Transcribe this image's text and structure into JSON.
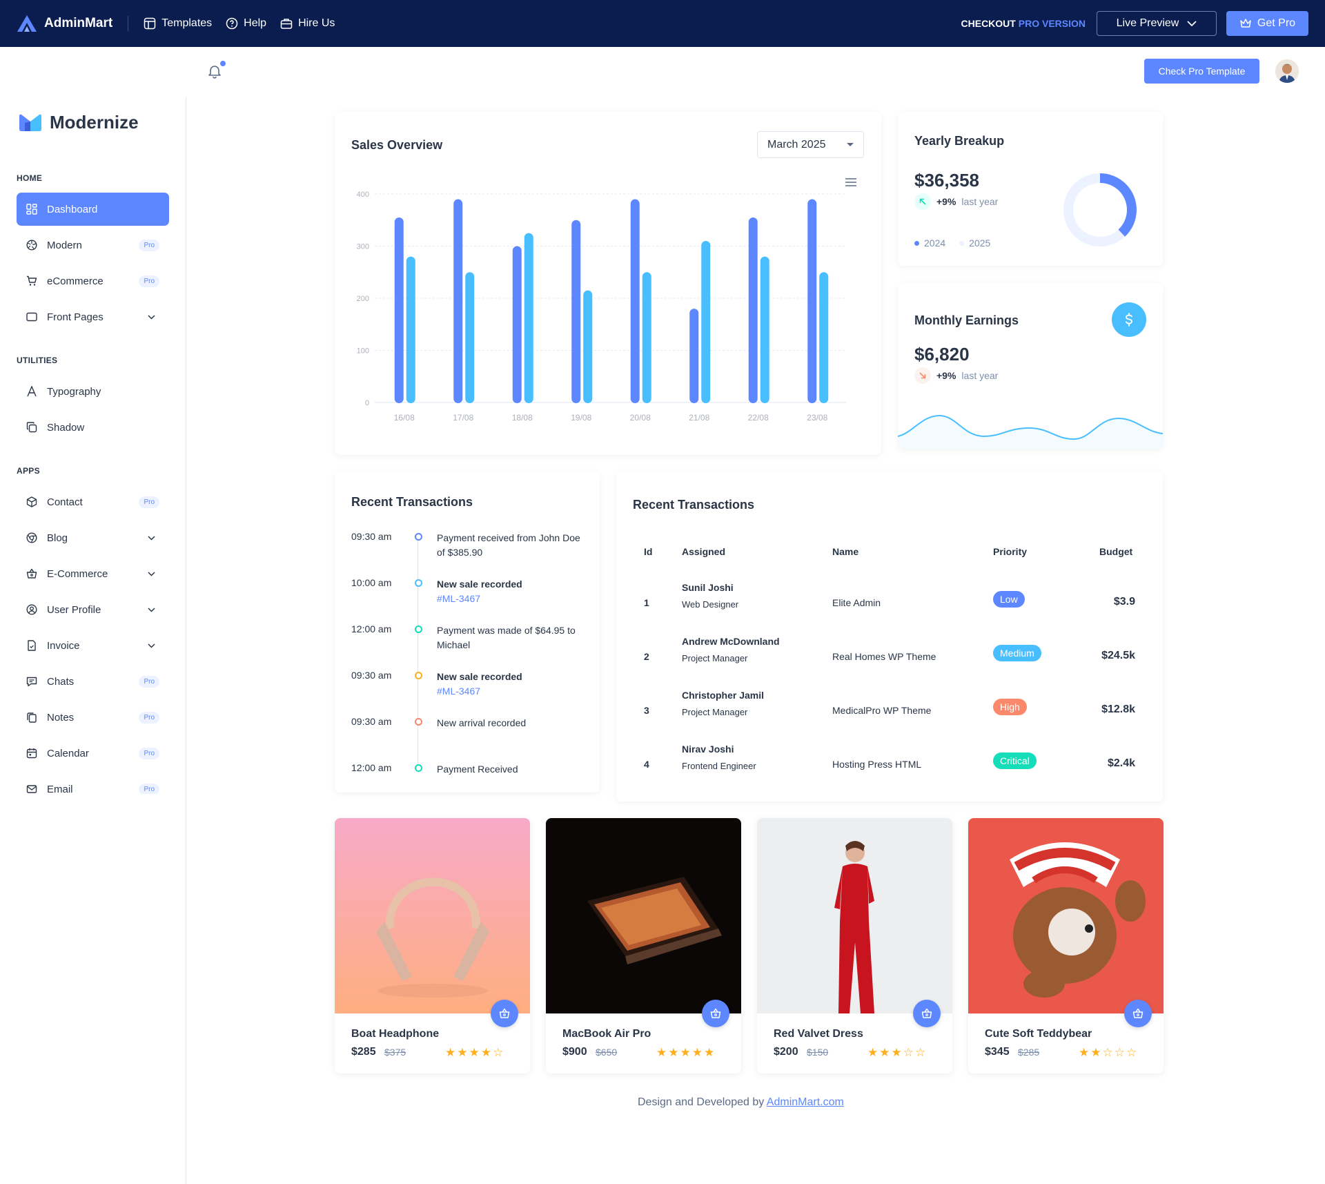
{
  "topbar": {
    "brand": "AdminMart",
    "nav": [
      "Templates",
      "Help",
      "Hire Us"
    ],
    "checkout": "CHECKOUT",
    "checkout_pro": "PRO VERSION",
    "live_preview": "Live Preview",
    "get_pro": "Get Pro"
  },
  "header": {
    "check_pro": "Check Pro Template"
  },
  "sidebar": {
    "brand": "Modernize",
    "sections": {
      "home": "HOME",
      "utilities": "UTILITIES",
      "apps": "APPS"
    },
    "items": [
      {
        "label": "Dashboard"
      },
      {
        "label": "Modern",
        "badge": "Pro"
      },
      {
        "label": "eCommerce",
        "badge": "Pro"
      },
      {
        "label": "Front Pages"
      },
      {
        "label": "Typography"
      },
      {
        "label": "Shadow"
      },
      {
        "label": "Contact",
        "badge": "Pro"
      },
      {
        "label": "Blog"
      },
      {
        "label": "E-Commerce"
      },
      {
        "label": "User Profile"
      },
      {
        "label": "Invoice"
      },
      {
        "label": "Chats",
        "badge": "Pro"
      },
      {
        "label": "Notes",
        "badge": "Pro"
      },
      {
        "label": "Calendar",
        "badge": "Pro"
      },
      {
        "label": "Email",
        "badge": "Pro"
      }
    ]
  },
  "sales": {
    "title": "Sales Overview",
    "month": "March 2025"
  },
  "chart_data": {
    "type": "bar",
    "categories": [
      "16/08",
      "17/08",
      "18/08",
      "19/08",
      "20/08",
      "21/08",
      "22/08",
      "23/08"
    ],
    "series": [
      {
        "values": [
          355,
          390,
          300,
          350,
          390,
          180,
          355,
          390
        ],
        "color": "#5d87ff"
      },
      {
        "values": [
          280,
          250,
          325,
          215,
          250,
          310,
          280,
          250
        ],
        "color": "#49beff"
      }
    ],
    "yticks": [
      0,
      100,
      200,
      300,
      400
    ],
    "ylim": [
      0,
      400
    ],
    "grid": true
  },
  "yearly": {
    "title": "Yearly Breakup",
    "amount": "$36,358",
    "change": "+9%",
    "period": "last year",
    "legend": [
      "2024",
      "2025"
    ],
    "donut_fraction": 0.38
  },
  "monthly": {
    "title": "Monthly Earnings",
    "amount": "$6,820",
    "change": "+9%",
    "period": "last year"
  },
  "timeline": {
    "title": "Recent Transactions",
    "items": [
      {
        "time": "09:30 am",
        "text": "Payment received from John Doe of $385.90",
        "color": "#5d87ff"
      },
      {
        "time": "10:00 am",
        "text": "New sale recorded",
        "link": "#ML-3467",
        "color": "#49beff"
      },
      {
        "time": "12:00 am",
        "text": "Payment was made of $64.95 to Michael",
        "color": "#13deb9"
      },
      {
        "time": "09:30 am",
        "text": "New sale recorded",
        "link": "#ML-3467",
        "color": "#ffae1f"
      },
      {
        "time": "09:30 am",
        "text": "New arrival recorded",
        "color": "#fa896b"
      },
      {
        "time": "12:00 am",
        "text": "Payment Received",
        "color": "#13deb9"
      }
    ]
  },
  "table": {
    "title": "Recent Transactions",
    "columns": [
      "Id",
      "Assigned",
      "Name",
      "Priority",
      "Budget"
    ],
    "rows": [
      {
        "id": "1",
        "assigned": "Sunil Joshi",
        "role": "Web Designer",
        "name": "Elite Admin",
        "priority": "Low",
        "priority_color": "#5d87ff",
        "budget": "$3.9"
      },
      {
        "id": "2",
        "assigned": "Andrew McDownland",
        "role": "Project Manager",
        "name": "Real Homes WP Theme",
        "priority": "Medium",
        "priority_color": "#49beff",
        "budget": "$24.5k"
      },
      {
        "id": "3",
        "assigned": "Christopher Jamil",
        "role": "Project Manager",
        "name": "MedicalPro WP Theme",
        "priority": "High",
        "priority_color": "#fa896b",
        "budget": "$12.8k"
      },
      {
        "id": "4",
        "assigned": "Nirav Joshi",
        "role": "Frontend Engineer",
        "name": "Hosting Press HTML",
        "priority": "Critical",
        "priority_color": "#13deb9",
        "budget": "$2.4k"
      }
    ]
  },
  "products": [
    {
      "name": "Boat Headphone",
      "price": "$285",
      "old": "$375",
      "rating": 4
    },
    {
      "name": "MacBook Air Pro",
      "price": "$900",
      "old": "$650",
      "rating": 5
    },
    {
      "name": "Red Valvet Dress",
      "price": "$200",
      "old": "$150",
      "rating": 3
    },
    {
      "name": "Cute Soft Teddybear",
      "price": "$345",
      "old": "$285",
      "rating": 2
    }
  ],
  "footer": {
    "text": "Design and Developed by",
    "link": "AdminMart.com"
  }
}
